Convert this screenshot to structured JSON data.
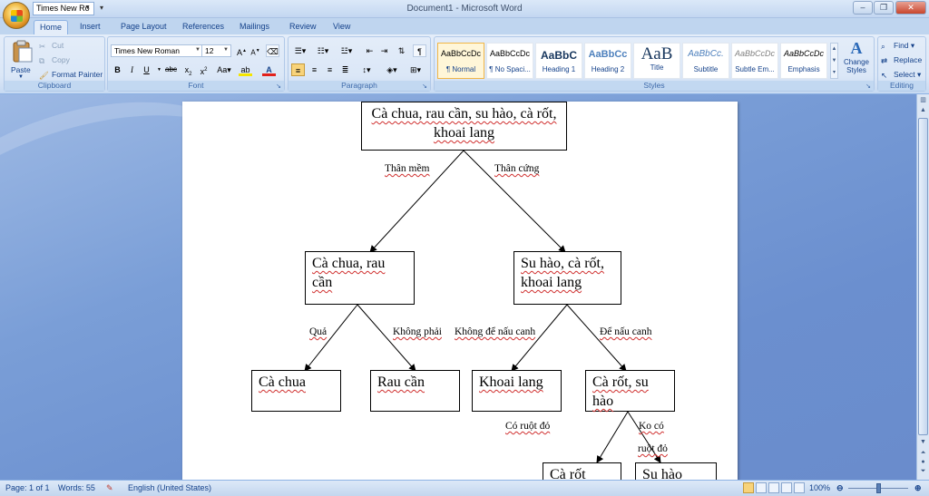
{
  "titlebar": {
    "title": "Document1 - Microsoft Word",
    "qat_font": "Times New Ro",
    "minimize": "‒",
    "restore": "❐",
    "close": "✕"
  },
  "tabs": [
    "Home",
    "Insert",
    "Page Layout",
    "References",
    "Mailings",
    "Review",
    "View"
  ],
  "ribbon": {
    "clipboard": {
      "label": "Clipboard",
      "paste": "Paste",
      "cut": "Cut",
      "copy": "Copy",
      "format_painter": "Format Painter"
    },
    "font": {
      "label": "Font",
      "family": "Times New Roman",
      "size": "12"
    },
    "paragraph": {
      "label": "Paragraph"
    },
    "styles": {
      "label": "Styles",
      "items": [
        {
          "preview": "AaBbCcDc",
          "name": "¶ Normal"
        },
        {
          "preview": "AaBbCcDc",
          "name": "¶ No Spaci..."
        },
        {
          "preview": "AaBbC",
          "name": "Heading 1"
        },
        {
          "preview": "AaBbCc",
          "name": "Heading 2"
        },
        {
          "preview": "AaB",
          "name": "Title"
        },
        {
          "preview": "AaBbCc.",
          "name": "Subtitle"
        },
        {
          "preview": "AaBbCcDc",
          "name": "Subtle Em..."
        },
        {
          "preview": "AaBbCcDc",
          "name": "Emphasis"
        }
      ],
      "change_styles": "Change Styles"
    },
    "editing": {
      "label": "Editing",
      "find": "Find",
      "replace": "Replace",
      "select": "Select"
    }
  },
  "document": {
    "root": "Cà chua, rau cần, su hào, cà rốt, khoai lang",
    "label_left": "Thân mềm",
    "label_right": "Thân cứng",
    "mid_left": "Cà chua, rau cần",
    "mid_right": "Su hào, cà rốt, khoai lang",
    "label_qua": "Quả",
    "label_khong_phai": "Không phải",
    "label_khong_de": "Không để nấu canh",
    "label_de": "Để nấu canh",
    "leaf_ca_chua": "Cà chua",
    "leaf_rau_can": "Rau cần",
    "leaf_khoai_lang": "Khoai lang",
    "node_ca_rot_su_hao": "Cà rốt, su hào",
    "label_co_ruot": "Có ruột đỏ",
    "label_ko_co": "Ko có",
    "label_ruot_do": "ruột đỏ",
    "leaf_ca_rot": "Cà rốt",
    "leaf_su_hao": "Su hào"
  },
  "statusbar": {
    "page": "Page: 1 of 1",
    "words": "Words: 55",
    "language": "English (United States)",
    "zoom": "100%"
  }
}
